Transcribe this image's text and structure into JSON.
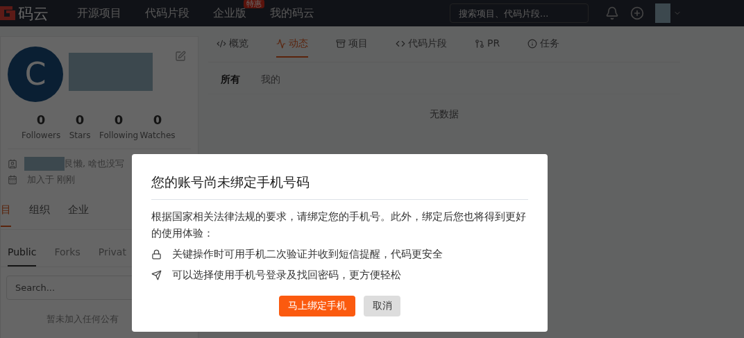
{
  "nav": {
    "logo_text": "码云",
    "items": [
      {
        "label": "开源项目"
      },
      {
        "label": "代码片段"
      },
      {
        "label": "企业版",
        "badge": "特惠"
      },
      {
        "label": "我的码云"
      }
    ],
    "search": {
      "placeholder": "搜索项目、代码片段..."
    }
  },
  "profile": {
    "avatar_letter": "C",
    "stats": [
      {
        "count": "0",
        "label": "Followers"
      },
      {
        "count": "0",
        "label": "Stars"
      },
      {
        "count": "0",
        "label": "Following"
      },
      {
        "count": "0",
        "label": "Watches"
      }
    ],
    "bio": "艮懒, 啥也没写",
    "joined": "加入于 刚刚",
    "tabs": [
      {
        "label": "目",
        "selected": true
      },
      {
        "label": "组织",
        "selected": false
      },
      {
        "label": "企业",
        "selected": false
      }
    ],
    "subtabs": [
      {
        "label": "Public",
        "selected": true
      },
      {
        "label": "Forks",
        "selected": false
      },
      {
        "label": "Privat",
        "selected": false
      }
    ],
    "search": {
      "placeholder": "Search..."
    },
    "empty": "暂未加入任何公有"
  },
  "main": {
    "tabs": [
      {
        "label": "概览",
        "selected": false
      },
      {
        "label": "动态",
        "selected": true
      },
      {
        "label": "项目",
        "selected": false
      },
      {
        "label": "代码片段",
        "selected": false
      },
      {
        "label": "PR",
        "selected": false
      },
      {
        "label": "任务",
        "selected": false
      }
    ],
    "filters": [
      {
        "label": "所有",
        "selected": true
      },
      {
        "label": "我的",
        "selected": false
      }
    ],
    "empty": "无数据"
  },
  "dialog": {
    "title": "您的账号尚未绑定手机号码",
    "body": "根据国家相关法律法规的要求，请绑定您的手机号。此外，绑定后您也将得到更好的使用体验：",
    "features": [
      {
        "text": "关键操作时可用手机二次验证并收到短信提醒，代码更安全"
      },
      {
        "text": "可以选择使用手机号登录及找回密码，更方便轻松"
      }
    ],
    "primary": "马上绑定手机",
    "cancel": "取消"
  }
}
